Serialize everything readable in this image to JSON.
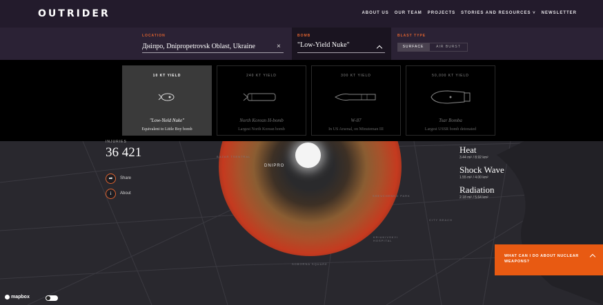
{
  "header": {
    "logo": "OUTRIDER",
    "nav": [
      "ABOUT US",
      "OUR TEAM",
      "PROJECTS",
      "STORIES AND RESOURCES ˅",
      "NEWSLETTER"
    ]
  },
  "controls": {
    "location_label": "LOCATION",
    "location_value": "Днiпро, Dnipropetrovsk Oblast, Ukraine",
    "clear_icon": "×",
    "bomb_label": "BOMB",
    "bomb_value": "\"Low-Yield Nuke\"",
    "blast_type_label": "BLAST TYPE",
    "surface_label": "SURFACE",
    "airburst_label": "AIR BURST",
    "selected_blast_type": "SURFACE"
  },
  "bombs": [
    {
      "yield": "10 KT YIELD",
      "name": "\"Low-Yield Nuke\"",
      "desc": "Equivalent to Little Boy bomb",
      "selected": true,
      "icon": "small-bomb-icon"
    },
    {
      "yield": "240 KT YIELD",
      "name": "North Korean H-bomb",
      "desc": "Largest North Korean bomb",
      "selected": false,
      "icon": "hbomb-icon"
    },
    {
      "yield": "300 KT YIELD",
      "name": "W-87",
      "desc": "In US Arsenal, on Minuteman III",
      "selected": false,
      "icon": "warhead-icon"
    },
    {
      "yield": "50,000 KT YIELD",
      "name": "Tsar Bomba",
      "desc": "Largest USSR bomb detonated",
      "selected": false,
      "icon": "tsar-bomba-icon"
    }
  ],
  "stats": {
    "injuries_label": "INJURIES",
    "injuries_value": "36 421",
    "share_label": "Share",
    "about_label": "About",
    "share_icon": "arrow-icon",
    "about_icon": "i"
  },
  "effects": [
    {
      "title": "Heat",
      "value": "3.44 mi² / 8.92 km²"
    },
    {
      "title": "Shock Wave",
      "value": "1.55 mi² / 4.00 km²"
    },
    {
      "title": "Radiation",
      "value": "2.18 mi² / 5.64 km²"
    }
  ],
  "map_labels": {
    "city": "DNIPRO",
    "district1": "BAZAR TSENTRAL",
    "district2": "SHEVCHENKO PARK",
    "district3": "CITY BEACH",
    "district4": "KRIUKIVSKYI HOSPITAL",
    "district5": "SOBORNA SQUARE"
  },
  "cta": {
    "text": "WHAT CAN I DO ABOUT NUCLEAR WEAPONS?"
  },
  "footer": {
    "mapbox": "mapbox"
  },
  "colors": {
    "accent": "#e85a12",
    "nav_bg": "#231b2c",
    "controls_bg": "#2b2235"
  }
}
